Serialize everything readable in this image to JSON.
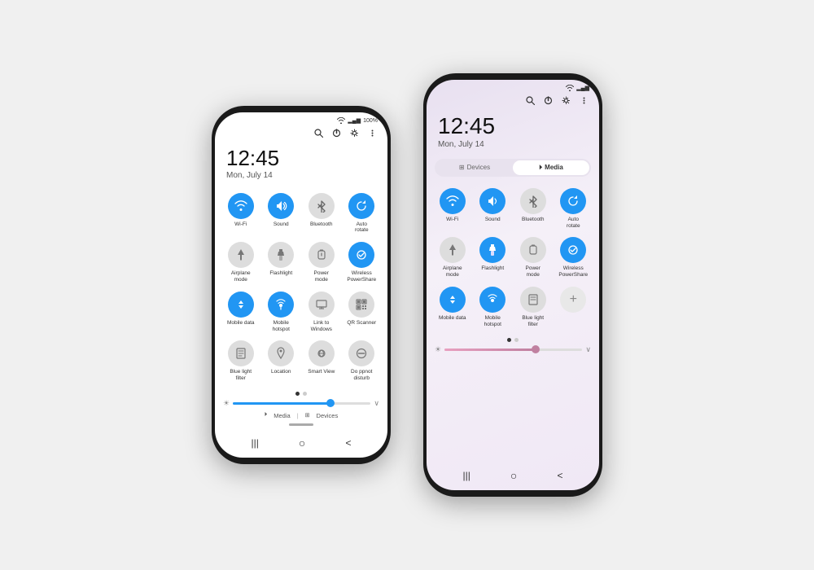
{
  "page": {
    "background": "#f0f0f0"
  },
  "phone_left": {
    "status": {
      "wifi": "📶",
      "signal": "WiFi+Signal",
      "battery": "100%"
    },
    "top_icons": [
      "search",
      "power",
      "settings",
      "more"
    ],
    "clock": {
      "time": "12:45",
      "date": "Mon, July 14"
    },
    "tiles": [
      {
        "id": "wifi",
        "label": "Wi-Fi",
        "active": true,
        "icon": "wifi"
      },
      {
        "id": "sound",
        "label": "Sound",
        "active": true,
        "icon": "sound"
      },
      {
        "id": "bluetooth",
        "label": "Bluetooth",
        "active": false,
        "icon": "bluetooth"
      },
      {
        "id": "autorotate",
        "label": "Auto\nrotate",
        "active": true,
        "icon": "rotate"
      },
      {
        "id": "airplane",
        "label": "Airplane\nmode",
        "active": false,
        "icon": "airplane"
      },
      {
        "id": "flashlight",
        "label": "Flashlight",
        "active": false,
        "icon": "flashlight"
      },
      {
        "id": "powermode",
        "label": "Power\nmode",
        "active": false,
        "icon": "power"
      },
      {
        "id": "wireless",
        "label": "Wireless\nPowerShare",
        "active": true,
        "icon": "wireless"
      },
      {
        "id": "mobiledata",
        "label": "Mobile data",
        "active": true,
        "icon": "data"
      },
      {
        "id": "mobilehotspot",
        "label": "Mobile\nhotspot",
        "active": true,
        "icon": "hotspot"
      },
      {
        "id": "linkwindows",
        "label": "Link to\nWindows",
        "active": false,
        "icon": "link"
      },
      {
        "id": "qrscanner",
        "label": "QR Scanner",
        "active": false,
        "icon": "qr"
      },
      {
        "id": "bluelight",
        "label": "Blue light\nfilter",
        "active": false,
        "icon": "blue"
      },
      {
        "id": "location",
        "label": "Location",
        "active": false,
        "icon": "location"
      },
      {
        "id": "smartview",
        "label": "Smart View",
        "active": false,
        "icon": "smartview"
      },
      {
        "id": "dnd",
        "label": "Do ppnot\ndisturb",
        "active": false,
        "icon": "dnd"
      }
    ],
    "brightness": 70,
    "bottom": {
      "media_label": "Media",
      "devices_label": "Devices"
    },
    "nav": [
      "|||",
      "○",
      "<"
    ]
  },
  "phone_right": {
    "status": {
      "wifi": "WiFi",
      "signal": "Signal"
    },
    "top_icons": [
      "search",
      "power",
      "settings",
      "more"
    ],
    "clock": {
      "time": "12:45",
      "date": "Mon, July 14"
    },
    "tabs": [
      {
        "id": "devices",
        "label": "Devices",
        "active": false
      },
      {
        "id": "media",
        "label": "Media",
        "active": true
      }
    ],
    "tiles": [
      {
        "id": "wifi",
        "label": "Wi-Fi",
        "active": true,
        "icon": "wifi"
      },
      {
        "id": "sound",
        "label": "Sound",
        "active": true,
        "icon": "sound"
      },
      {
        "id": "bluetooth",
        "label": "Bluetooth",
        "active": false,
        "icon": "bluetooth"
      },
      {
        "id": "autorotate",
        "label": "Auto\nrotate",
        "active": true,
        "icon": "rotate"
      },
      {
        "id": "airplane",
        "label": "Airplane\nmode",
        "active": false,
        "icon": "airplane"
      },
      {
        "id": "flashlight",
        "label": "Flashlight",
        "active": true,
        "icon": "flashlight"
      },
      {
        "id": "powermode",
        "label": "Power\nmode",
        "active": false,
        "icon": "power"
      },
      {
        "id": "wireless",
        "label": "Wireless\nPowerShare",
        "active": true,
        "icon": "wireless"
      },
      {
        "id": "mobiledata",
        "label": "Mobile\ndata",
        "active": true,
        "icon": "data"
      },
      {
        "id": "mobilehotspot",
        "label": "Mobile\nhotspot",
        "active": true,
        "icon": "hotspot"
      },
      {
        "id": "bluelight",
        "label": "Blue light\nfilter",
        "active": false,
        "icon": "blue"
      },
      {
        "id": "plus",
        "label": "",
        "active": false,
        "icon": "plus"
      }
    ],
    "brightness": 65,
    "nav": [
      "|||",
      "○",
      "<"
    ]
  }
}
